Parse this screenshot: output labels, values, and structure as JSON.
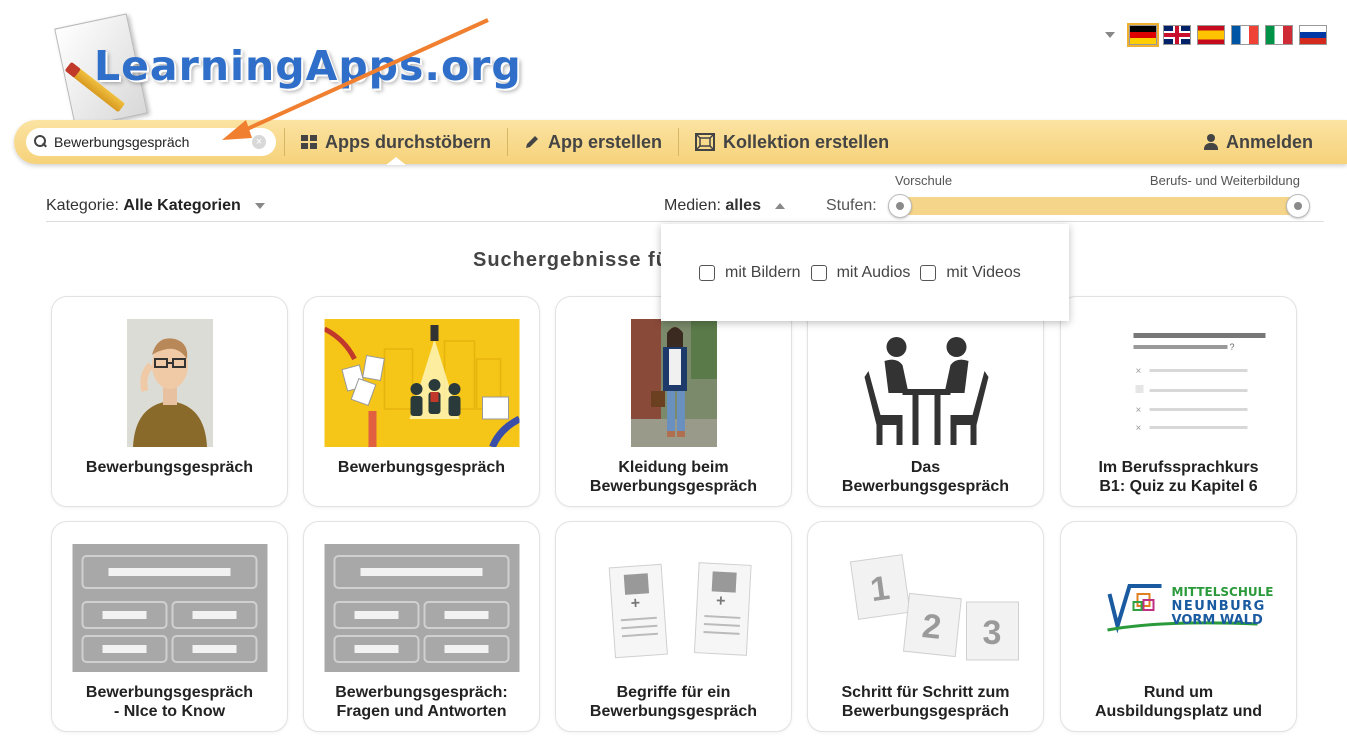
{
  "logo": {
    "text": "LearningApps.org"
  },
  "languages": [
    {
      "code": "de",
      "icon": "german-flag-icon",
      "active": true
    },
    {
      "code": "en",
      "icon": "uk-flag-icon"
    },
    {
      "code": "es",
      "icon": "spanish-flag-icon"
    },
    {
      "code": "fr",
      "icon": "french-flag-icon"
    },
    {
      "code": "it",
      "icon": "italian-flag-icon"
    },
    {
      "code": "ru",
      "icon": "russian-flag-icon"
    }
  ],
  "navbar": {
    "search_value": "Bewerbungsgespräch",
    "clear_symbol": "×",
    "browse": "Apps durchstöbern",
    "create_app": "App erstellen",
    "create_collection": "Kollektion erstellen",
    "login": "Anmelden"
  },
  "filters": {
    "category_label": "Kategorie:",
    "category_value": "Alle Kategorien",
    "media_label": "Medien:",
    "media_value": "alles",
    "levels_label": "Stufen:",
    "level_min": "Vorschule",
    "level_max": "Berufs- und Weiterbildung"
  },
  "media_options": {
    "images": "mit Bildern",
    "audio": "mit Audios",
    "video": "mit Videos"
  },
  "results": {
    "title": "Suchergebnisse fü",
    "cards": [
      {
        "line1": "Bewerbungsgespräch",
        "line2": ""
      },
      {
        "line1": "Bewerbungsgespräch",
        "line2": ""
      },
      {
        "line1": "Kleidung beim",
        "line2": "Bewerbungsgespräch"
      },
      {
        "line1": "Das",
        "line2": "Bewerbungsgespräch"
      },
      {
        "line1": "Im Berufssprachkurs",
        "line2": "B1: Quiz zu Kapitel 6"
      },
      {
        "line1": "Bewerbungsgespräch",
        "line2": "- NIce to Know"
      },
      {
        "line1": "Bewerbungsgespräch:",
        "line2": "Fragen und Antworten"
      },
      {
        "line1": "Begriffe für ein",
        "line2": "Bewerbungsgespräch"
      },
      {
        "line1": "Schritt für Schritt zum",
        "line2": "Bewerbungsgespräch"
      },
      {
        "line1": "Rund um",
        "line2": "Ausbildungsplatz und"
      }
    ],
    "school_logo": {
      "line1": "MITTELSCHULE",
      "line2": "NEUNBURG",
      "line3": "VORM WALD"
    },
    "step_numbers": [
      "1",
      "2",
      "3"
    ]
  },
  "colors": {
    "navbar": "#f6d27a",
    "logo_blue": "#2f6fc9",
    "annotation_arrow": "#f08030"
  }
}
